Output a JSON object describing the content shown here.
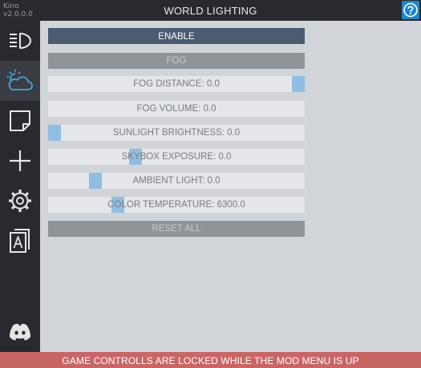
{
  "app": {
    "name": "Kino",
    "version": "v2.0.0.0"
  },
  "window": {
    "title": "WORLD LIGHTING"
  },
  "sidebar": {
    "items": [
      {
        "icon": "headlight-icon",
        "active": false
      },
      {
        "icon": "weather-cloud-sun-icon",
        "active": true
      },
      {
        "icon": "note-icon",
        "active": false
      },
      {
        "icon": "plus-icon",
        "active": false
      },
      {
        "icon": "gear-icon",
        "active": false
      },
      {
        "icon": "cards-icon",
        "active": false
      },
      {
        "icon": "discord-icon",
        "active": false
      }
    ]
  },
  "controls": {
    "enable_label": "ENABLE",
    "fog_label": "FOG",
    "fog_distance": {
      "label": "FOG DISTANCE: 0.0",
      "position": 1.0
    },
    "fog_volume": {
      "label": "FOG VOLUME: 0.0",
      "position": null
    },
    "sunlight_brightness": {
      "label": "SUNLIGHT BRIGHTNESS: 0.0",
      "position": 0.0
    },
    "skybox_exposure": {
      "label": "SKYBOX EXPOSURE: 0.0",
      "position": 0.33
    },
    "ambient_light": {
      "label": "AMBIENT LIGHT: 0.0",
      "position": 0.17
    },
    "color_temperature": {
      "label": "COLOR TEMPERATURE: 6300.0",
      "position": 0.27
    },
    "reset_label": "RESET ALL"
  },
  "footer": {
    "message": "GAME CONTROLLS ARE LOCKED WHILE THE MOD MENU IS UP"
  },
  "colors": {
    "accent": "#1f86c9",
    "enable": "#4b5b70",
    "disabled": "#8f949b",
    "slider_handle": "#8fbfe0",
    "warning": "#c86666",
    "active_icon": "#4aa3df"
  }
}
